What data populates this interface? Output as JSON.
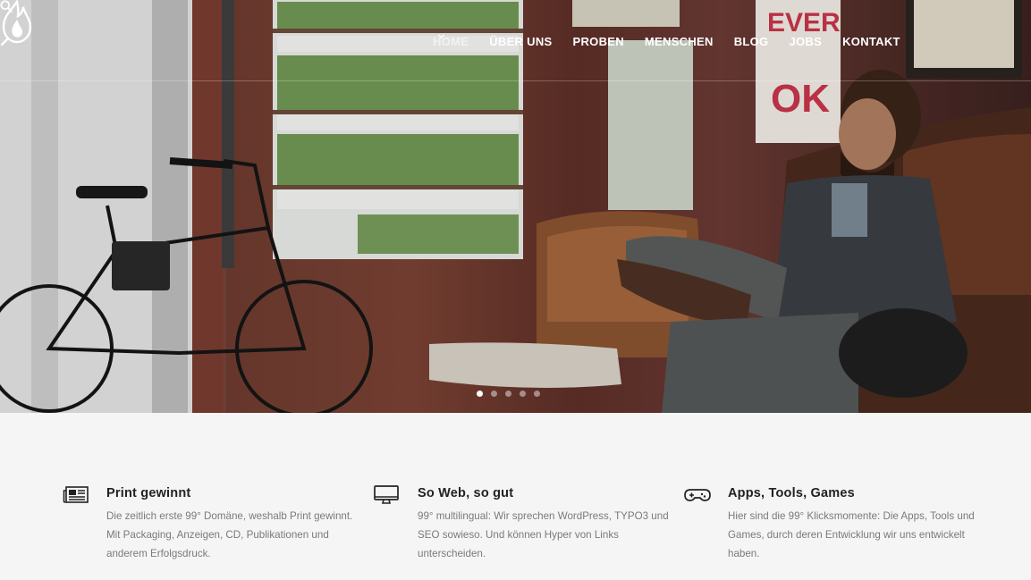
{
  "header": {
    "nav": [
      {
        "label": "HOME",
        "active": true
      },
      {
        "label": "ÜBER UNS"
      },
      {
        "label": "PROBEN",
        "has_dropdown": true
      },
      {
        "label": "MENSCHEN"
      },
      {
        "label": "BLOG"
      },
      {
        "label": "JOBS"
      },
      {
        "label": "KONTAKT"
      }
    ],
    "logo_icon": "flame-logo",
    "search_icon": "search-icon"
  },
  "hero": {
    "slides": 5,
    "active_slide": 1
  },
  "features": [
    {
      "icon": "newspaper-icon",
      "title": "Print gewinnt",
      "text": "Die zeitlich erste 99° Domäne, weshalb Print gewinnt. Mit Packaging, Anzeigen, CD, Publikationen und anderem Erfolgsdruck."
    },
    {
      "icon": "monitor-icon",
      "title": "So Web, so gut",
      "text": "99° multilingual: Wir sprechen WordPress, TYPO3 und SEO sowieso. Und können Hyper von Links unterscheiden."
    },
    {
      "icon": "gamepad-icon",
      "title": "Apps, Tools, Games",
      "text": "Hier sind die 99° Klicksmomente: Die Apps, Tools und Games, durch deren Entwicklung wir uns entwickelt haben."
    }
  ],
  "colors": {
    "page_bg": "#f5f5f5",
    "nav_text": "#ffffff",
    "title_text": "#222222",
    "body_text": "#7a7a7a"
  }
}
